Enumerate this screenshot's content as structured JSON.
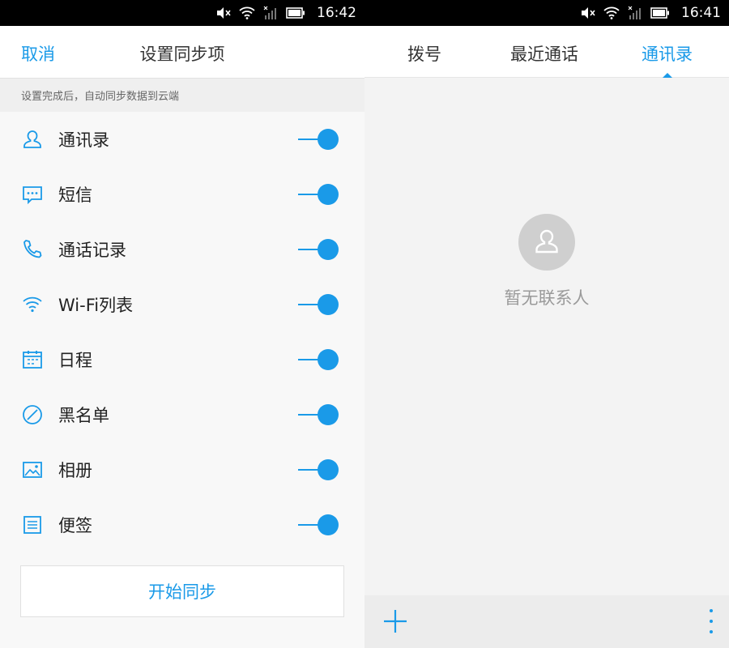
{
  "left_screen": {
    "status": {
      "time": "16:42"
    },
    "header": {
      "cancel_label": "取消",
      "title": "设置同步项"
    },
    "hint": "设置完成后，自动同步数据到云端",
    "items": [
      {
        "label": "通讯录",
        "icon": "contact-icon",
        "enabled": true
      },
      {
        "label": "短信",
        "icon": "message-icon",
        "enabled": true
      },
      {
        "label": "通话记录",
        "icon": "phone-icon",
        "enabled": true
      },
      {
        "label": "Wi-Fi列表",
        "icon": "wifi-icon",
        "enabled": true
      },
      {
        "label": "日程",
        "icon": "calendar-icon",
        "enabled": true
      },
      {
        "label": "黑名单",
        "icon": "block-icon",
        "enabled": true
      },
      {
        "label": "相册",
        "icon": "photo-icon",
        "enabled": true
      },
      {
        "label": "便签",
        "icon": "note-icon",
        "enabled": true
      }
    ],
    "start_button": "开始同步"
  },
  "right_screen": {
    "status": {
      "time": "16:41"
    },
    "tabs": [
      {
        "label": "拨号",
        "active": false
      },
      {
        "label": "最近通话",
        "active": false
      },
      {
        "label": "通讯录",
        "active": true
      }
    ],
    "empty_text": "暂无联系人"
  },
  "colors": {
    "accent": "#1a9ae8",
    "status_bar": "#000000",
    "empty_avatar": "#cfcfcf"
  }
}
